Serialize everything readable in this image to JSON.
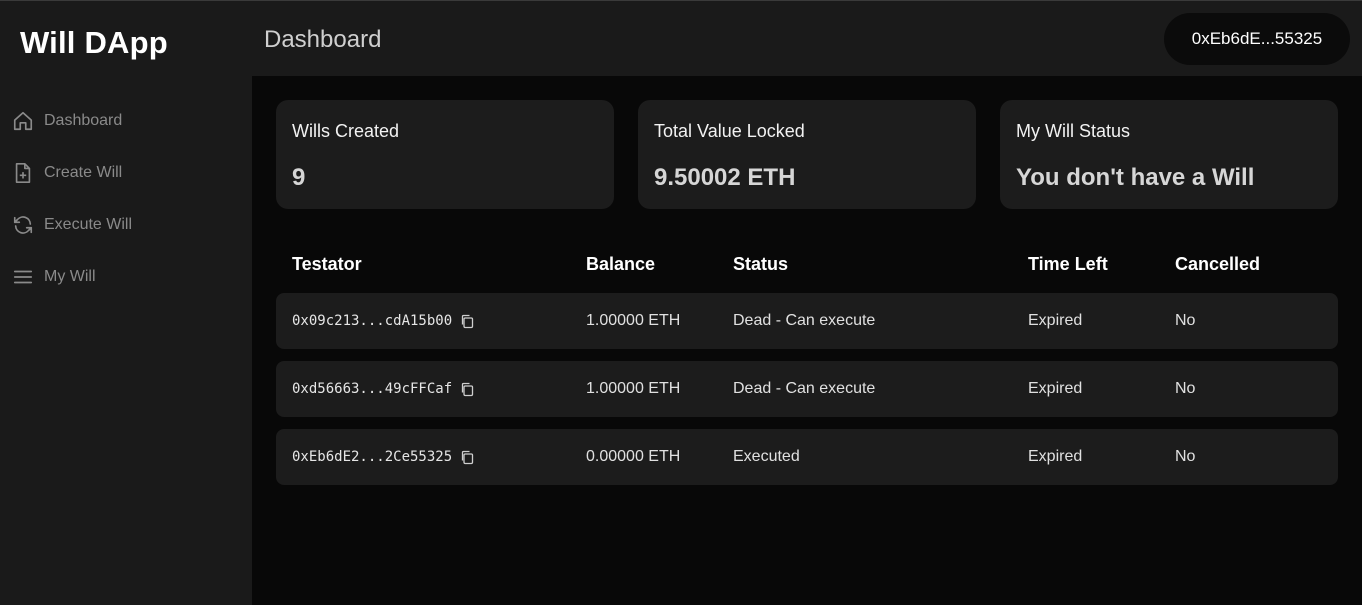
{
  "app": {
    "title": "Will DApp"
  },
  "sidebar": {
    "items": [
      {
        "label": "Dashboard",
        "icon": "home-icon"
      },
      {
        "label": "Create Will",
        "icon": "file-plus-icon"
      },
      {
        "label": "Execute Will",
        "icon": "refresh-icon"
      },
      {
        "label": "My Will",
        "icon": "menu-icon"
      }
    ]
  },
  "header": {
    "title": "Dashboard",
    "wallet": "0xEb6dE...55325"
  },
  "stats": [
    {
      "label": "Wills Created",
      "value": "9"
    },
    {
      "label": "Total Value Locked",
      "value": "9.50002 ETH"
    },
    {
      "label": "My Will Status",
      "value": "You don't have a Will"
    }
  ],
  "table": {
    "headers": [
      "Testator",
      "Balance",
      "Status",
      "Time Left",
      "Cancelled"
    ],
    "rows": [
      {
        "testator": "0x09c213...cdA15b00",
        "balance": "1.00000 ETH",
        "status": "Dead - Can execute",
        "time_left": "Expired",
        "cancelled": "No"
      },
      {
        "testator": "0xd56663...49cFFCaf",
        "balance": "1.00000 ETH",
        "status": "Dead - Can execute",
        "time_left": "Expired",
        "cancelled": "No"
      },
      {
        "testator": "0xEb6dE2...2Ce55325",
        "balance": "0.00000 ETH",
        "status": "Executed",
        "time_left": "Expired",
        "cancelled": "No"
      }
    ]
  },
  "colors": {
    "background": "#080808",
    "panel": "#1a1a1a",
    "card": "#1c1c1c",
    "muted_text": "#8a8a8a"
  }
}
